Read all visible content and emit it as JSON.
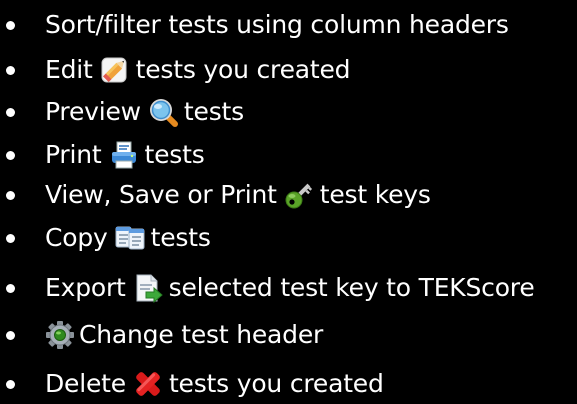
{
  "colors": {
    "background": "#000000",
    "text": "#ffffff"
  },
  "items": [
    {
      "text_before": "Sort/filter tests using column headers",
      "icon": "",
      "text_after": ""
    },
    {
      "text_before": "Edit",
      "icon": "edit-pencil-icon",
      "text_after": "tests you created"
    },
    {
      "text_before": "Preview",
      "icon": "magnifier-icon",
      "text_after": "tests"
    },
    {
      "text_before": "Print",
      "icon": "printer-icon",
      "text_after": "tests"
    },
    {
      "text_before": "View, Save or Print",
      "icon": "key-icon",
      "text_after": "test keys"
    },
    {
      "text_before": "Copy",
      "icon": "copy-documents-icon",
      "text_after": "tests"
    },
    {
      "text_before": "Export",
      "icon": "export-document-icon",
      "text_after": "selected test key to TEKScore"
    },
    {
      "text_before": "",
      "icon": "gear-icon",
      "text_after": "Change test header"
    },
    {
      "text_before": "Delete",
      "icon": "delete-x-icon",
      "text_after": "tests you created"
    }
  ]
}
